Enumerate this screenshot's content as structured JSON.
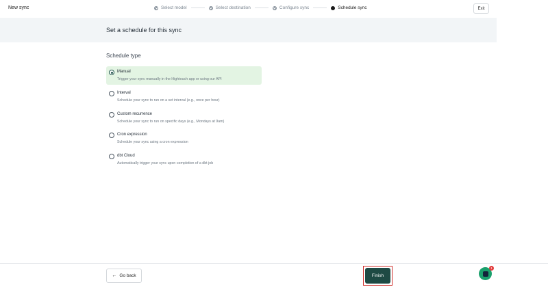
{
  "app": {
    "title": "New sync"
  },
  "stepper": {
    "steps": [
      {
        "label": "Select model",
        "state": "done"
      },
      {
        "label": "Select destination",
        "state": "done"
      },
      {
        "label": "Configure sync",
        "state": "done"
      },
      {
        "label": "Schedule sync",
        "state": "active"
      }
    ]
  },
  "header": {
    "exit_label": "Exit",
    "page_title": "Set a schedule for this sync"
  },
  "schedule": {
    "section_label": "Schedule type",
    "selected": "Manual",
    "options": [
      {
        "label": "Manual",
        "description": "Trigger your sync manually in the Hightouch app or using our API"
      },
      {
        "label": "Interval",
        "description": "Schedule your sync to run on a set interval (e.g., once per hour)"
      },
      {
        "label": "Custom recurrence",
        "description": "Schedule your sync to run on specific days (e.g., Mondays at 9am)"
      },
      {
        "label": "Cron expression",
        "description": "Schedule your sync using a cron expression"
      },
      {
        "label": "dbt Cloud",
        "description": "Automatically trigger your sync upon completion of a dbt job"
      }
    ]
  },
  "footer": {
    "back_label": "Go back",
    "back_icon": "arrow-left-icon",
    "finish_label": "Finish"
  },
  "chat": {
    "icon": "chat-icon",
    "badge_count": "1"
  },
  "colors": {
    "primary": "#1e4a44",
    "selected_bg": "#e3f4e3",
    "highlight": "#d0302c",
    "chat": "#1aa06c"
  }
}
